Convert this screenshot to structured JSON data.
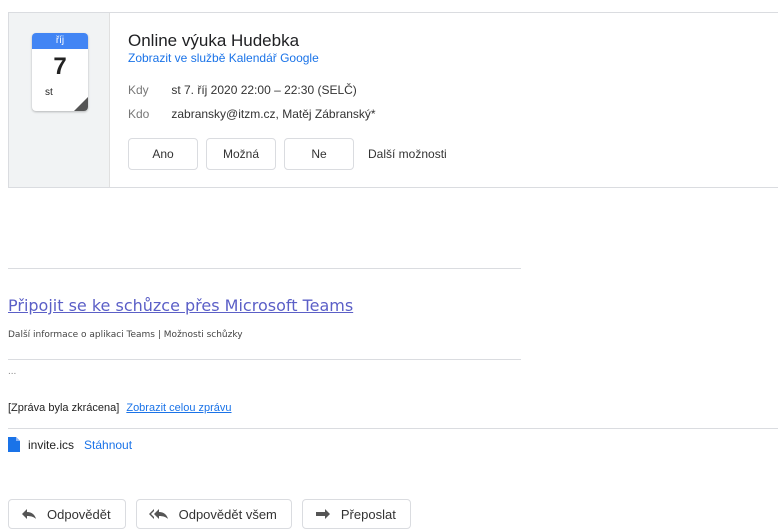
{
  "event": {
    "month": "říj",
    "day": "7",
    "weekday": "st",
    "title": "Online výuka Hudebka",
    "calendar_link": "Zobrazit ve službě Kalendář Google",
    "when_label": "Kdy",
    "when_value": "st 7. říj 2020 22:00 – 22:30 (SELČ)",
    "who_label": "Kdo",
    "who_value": "zabransky@itzm.cz, Matěj Zábranský*",
    "rsvp": {
      "yes": "Ano",
      "maybe": "Možná",
      "no": "Ne",
      "more": "Další možnosti"
    }
  },
  "body": {
    "teams_link": "Připojit se ke schůzce přes Microsoft Teams",
    "teams_info": "Další informace o aplikaci Teams",
    "teams_separator": "|",
    "teams_options": "Možnosti schůzky",
    "ellipsis": "...",
    "truncated_text": "[Zpráva byla zkrácena]",
    "show_full": "Zobrazit celou zprávu"
  },
  "attachment": {
    "name": "invite.ics",
    "download": "Stáhnout"
  },
  "actions": {
    "reply": "Odpovědět",
    "reply_all": "Odpovědět všem",
    "forward": "Přeposlat"
  },
  "colors": {
    "calendar_blue": "#4285f4",
    "link_blue": "#1a73e8",
    "teams_purple": "#5b5fc7"
  }
}
